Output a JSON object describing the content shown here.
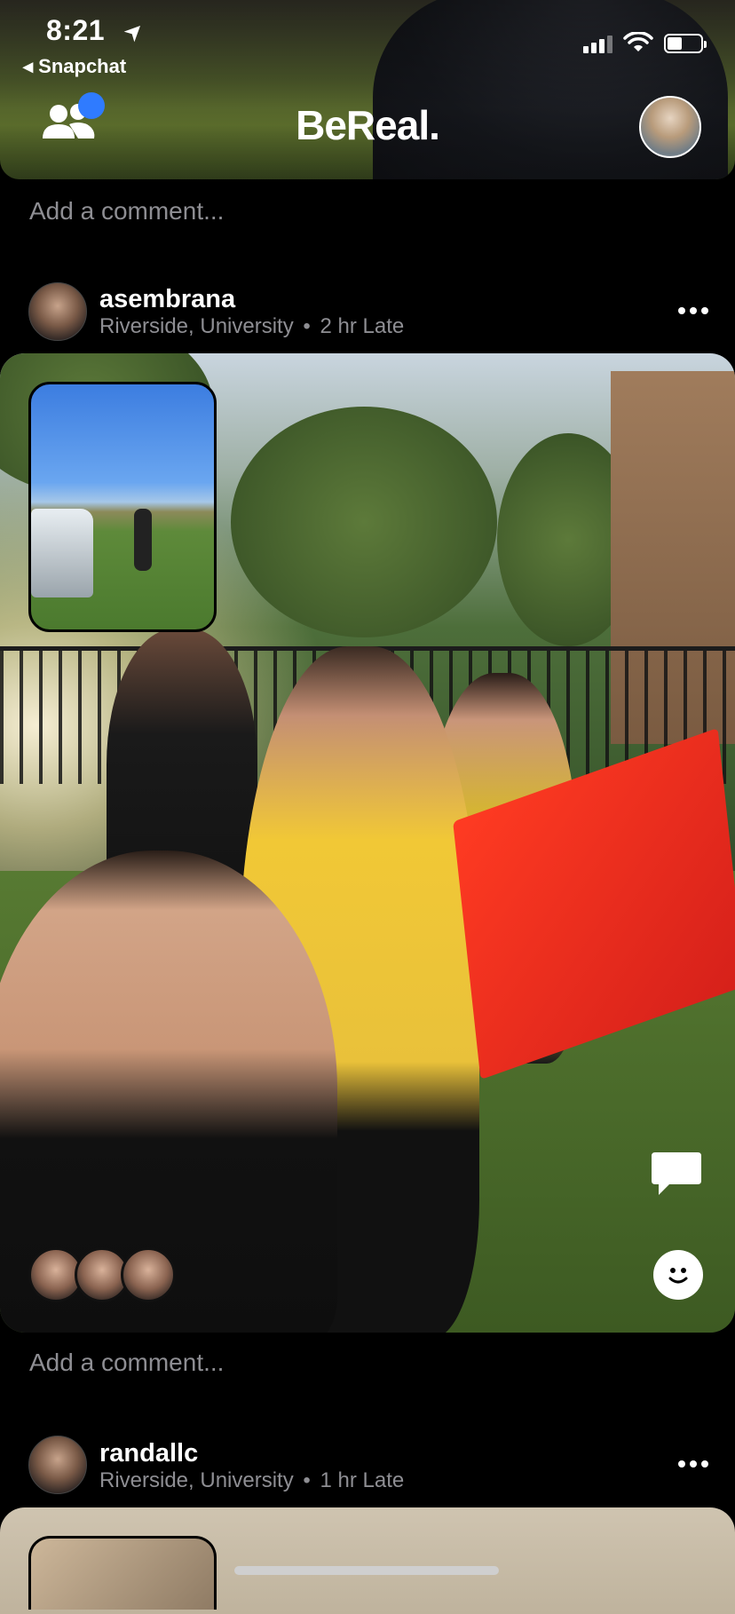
{
  "status_bar": {
    "time": "8:21",
    "location_arrow": "➤",
    "back_label": "◂ Snapchat"
  },
  "header": {
    "brand": "BeReal.",
    "friends_icon": "friends-icon",
    "notification_color": "#2f7bff"
  },
  "top_post": {
    "comment_placeholder": "Add a comment..."
  },
  "posts": [
    {
      "username": "asembrana",
      "location": "Riverside, University",
      "separator": "•",
      "time": "2 hr Late",
      "comment_placeholder": "Add a comment..."
    },
    {
      "username": "randallc",
      "location": "Riverside, University",
      "separator": "•",
      "time": "1 hr Late"
    }
  ],
  "colors": {
    "background": "#000000",
    "secondary_text": "#8e8e93",
    "flag": "#e02a1f"
  }
}
